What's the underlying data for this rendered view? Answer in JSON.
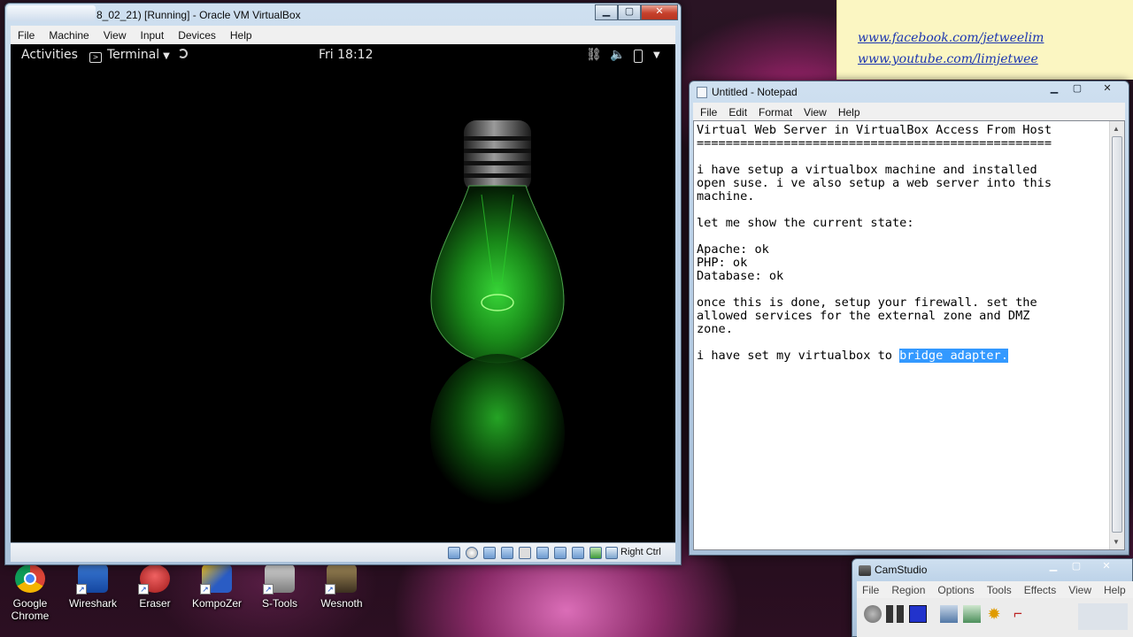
{
  "desktop": {
    "sticky_links": [
      "www.facebook.com/jetweelim",
      "www.youtube.com/limjetwee"
    ],
    "icons": [
      {
        "label": "Google Chrome",
        "icon": "chrome-icon"
      },
      {
        "label": "Wireshark",
        "icon": "wireshark-icon"
      },
      {
        "label": "Eraser",
        "icon": "eraser-icon"
      },
      {
        "label": "KompoZer",
        "icon": "kompozer-icon"
      },
      {
        "label": "S-Tools",
        "icon": "s-tools-icon"
      },
      {
        "label": "Wesnoth",
        "icon": "wesnoth-icon"
      }
    ]
  },
  "virtualbox": {
    "title": "8_02_21) [Running] - Oracle VM VirtualBox",
    "menu": [
      "File",
      "Machine",
      "View",
      "Input",
      "Devices",
      "Help"
    ],
    "gnome": {
      "activities": "Activities",
      "app_menu": "Terminal",
      "clock": "Fri 18:12",
      "tray_icons": [
        "network-icon",
        "volume-icon",
        "battery-icon",
        "chevron-down-icon"
      ]
    },
    "host_key": "Right Ctrl"
  },
  "notepad": {
    "title": "Untitled - Notepad",
    "menu": [
      "File",
      "Edit",
      "Format",
      "View",
      "Help"
    ],
    "text_before_selection": "Virtual Web Server in VirtualBox Access From Host\n=================================================\n\ni have setup a virtualbox machine and installed\nopen suse. i ve also setup a web server into this\nmachine.\n\nlet me show the current state:\n\nApache: ok\nPHP: ok\nDatabase: ok\n\nonce this is done, setup your firewall. set the\nallowed services for the external zone and DMZ\nzone.\n\ni have set my virtualbox to ",
    "selected_text": "bridge adapter."
  },
  "camstudio": {
    "title": "CamStudio",
    "menu": [
      "File",
      "Region",
      "Options",
      "Tools",
      "Effects",
      "View",
      "Help"
    ]
  },
  "colors": {
    "bulb_glow": "#1fa81f",
    "selection": "#3399ff",
    "close_button": "#c7412c"
  }
}
